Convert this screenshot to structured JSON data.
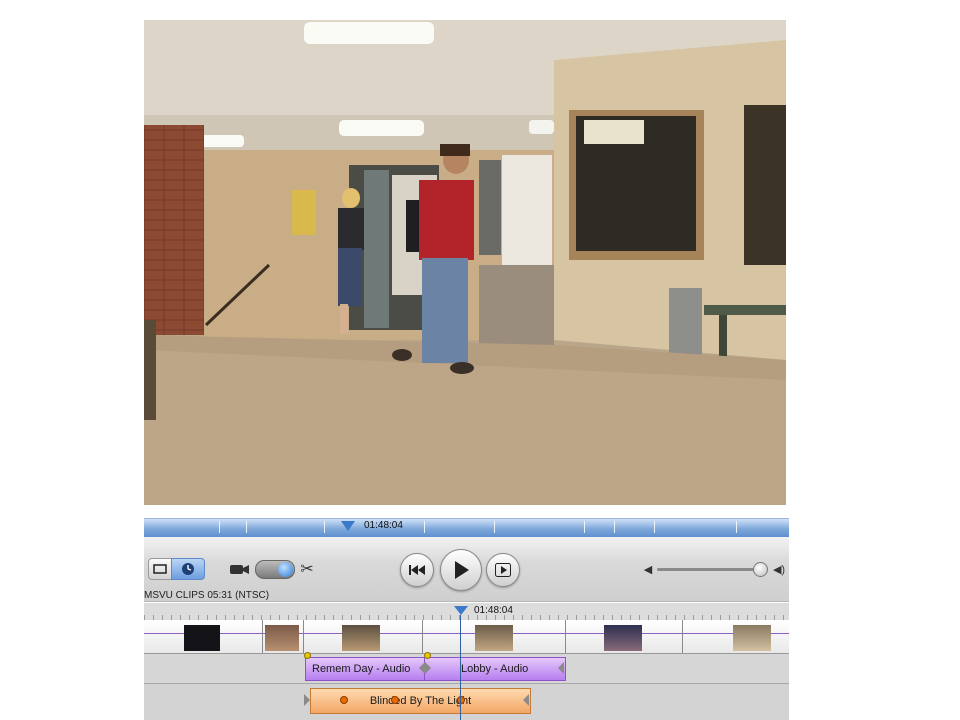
{
  "scrubber": {
    "time": "01:48:04"
  },
  "controls": {
    "icons": {
      "clip_view": "clip-view-icon",
      "time_view": "clock-icon",
      "camera": "camera-icon",
      "scissors": "scissors-icon",
      "rewind": "rewind-icon",
      "play": "play-icon",
      "fullscreen_play": "fullscreen-play-icon",
      "volume_low": "speaker-low-icon",
      "volume_high": "speaker-high-icon"
    },
    "volume_level": 0.95
  },
  "project": {
    "info": "MSVU CLIPS  05:31 (NTSC)"
  },
  "timeline": {
    "time": "01:48:04",
    "audio_clips": [
      {
        "label": "Remem Day - Audio"
      },
      {
        "label": "Lobby - Audio"
      },
      {
        "label": "Blinded By The Light"
      }
    ]
  },
  "colors": {
    "accent_blue": "#3b79c9",
    "audio_clip_purple": "#b77ef0",
    "music_clip_orange": "#f3a766"
  }
}
